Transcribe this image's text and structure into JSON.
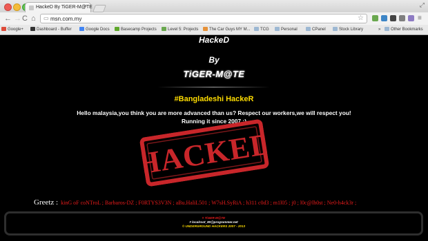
{
  "browser": {
    "tab_title": "HackeD By TiGER-M@TE",
    "tab_close": "×",
    "url": "msn.com.my",
    "nav_back": "←",
    "nav_forward": "→",
    "nav_reload": "C",
    "nav_home": "⌂",
    "bookmark_star": "☆",
    "bookmarks": [
      "Google+",
      "Dashboard - Buffer",
      "Google Docs",
      "Basecamp Projects",
      "Level 5: Projects",
      "The Car Guys MY M...",
      "TCG",
      "Personal",
      "CPanel",
      "Stock Library"
    ],
    "bookmarks_more": "»",
    "other_bookmarks": "Other Bookmarks"
  },
  "page": {
    "title_hacked": "HackeD",
    "title_by": "By",
    "title_name": "TiGER-M@TE",
    "subtitle": "#Bangladeshi HackeR",
    "message_line1": "Hello malaysia,you think you are more advanced than us? Respect our workers,we will respect you!",
    "message_line2": "Running it since 2007 :)",
    "stamp_text": "HACKED",
    "greetz_label": "Greetz :",
    "greetz_names": "kinG oF coNTroL ; Barbaros-DZ ; F0RTYS3V3N ; aBu.HaliL501 ; W7sH.SyRiA ; h311 c0d3 ; m1l05 ; j0 ; l0c@lh0st ; Ne0-h4ck3r ;",
    "footer_line1": "# TiGER-M@TE",
    "footer_line2": "# localroot_80@programmer.net",
    "footer_line3": "© UNDERGROUND HACKERS 2007 - 2013"
  },
  "colors": {
    "accent_yellow": "#ffdd00",
    "accent_red": "#e81b1b",
    "stamp_red": "#c8262a",
    "background": "#000000"
  }
}
